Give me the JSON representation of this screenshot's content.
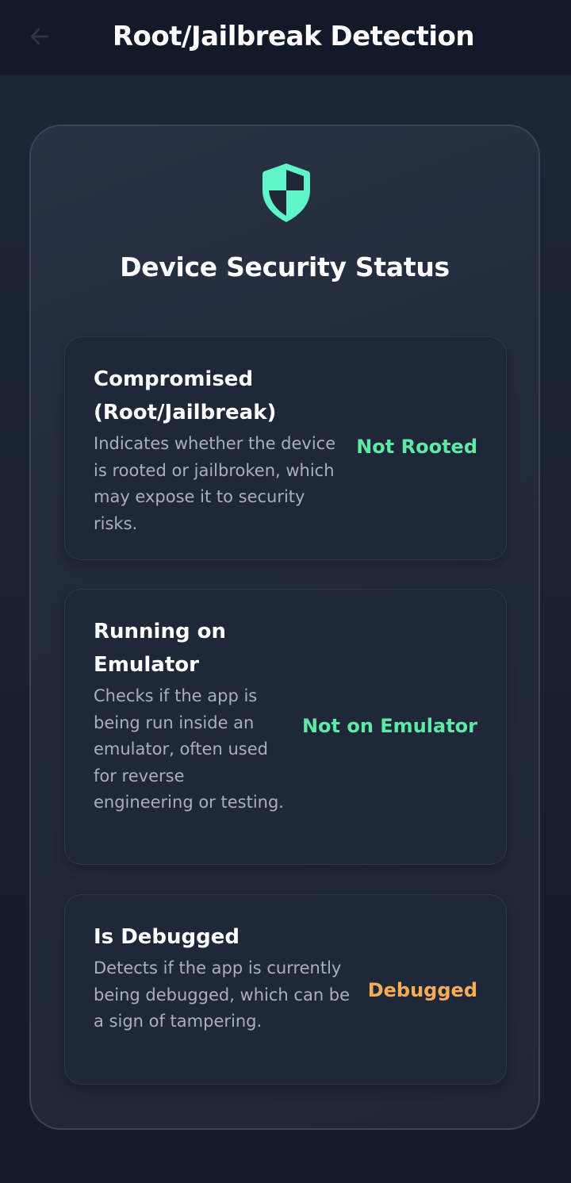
{
  "app_bar": {
    "title": "Root/Jailbreak Detection",
    "back_icon": "arrow-left-icon"
  },
  "panel": {
    "icon": "shield-icon",
    "title": "Device Security Status"
  },
  "checks": [
    {
      "title": "Compromised (Root/Jailbreak)",
      "description": "Indicates whether the device is rooted or jailbroken, which may expose it to security risks.",
      "status": "Not Rooted",
      "status_color": "#5ee9a6"
    },
    {
      "title": "Running on Emulator",
      "description": "Checks if the app is being run inside an emulator, often used for reverse engineering or testing.",
      "status": "Not on Emulator",
      "status_color": "#5ee9a6"
    },
    {
      "title": "Is Debugged",
      "description": "Detects if the app is currently being debugged, which can be a sign of tampering.",
      "status": "Debugged",
      "status_color": "#f6ad55"
    }
  ],
  "colors": {
    "accent": "#5ff5c8",
    "ok": "#5ee9a6",
    "warning": "#f6ad55"
  }
}
